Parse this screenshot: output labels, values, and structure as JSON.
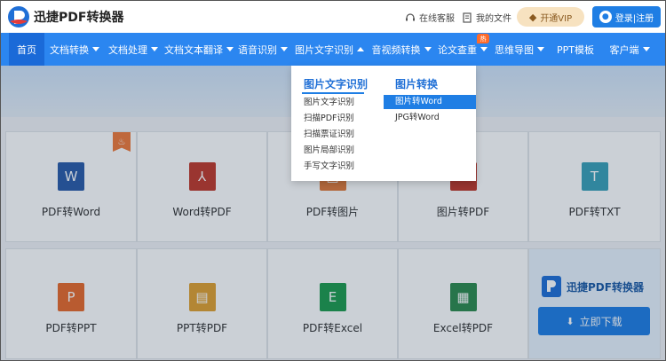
{
  "header": {
    "brand": "迅捷PDF转换器",
    "links": [
      {
        "label": "在线客服",
        "icon": "headset-icon"
      },
      {
        "label": "我的文件",
        "icon": "file-icon"
      }
    ],
    "vip_label": "开通VIP",
    "login_label": "登录|注册"
  },
  "nav": {
    "items": [
      {
        "label": "首页",
        "active": true,
        "caret": false
      },
      {
        "label": "文档转换",
        "caret": true
      },
      {
        "label": "文档处理",
        "caret": true
      },
      {
        "label": "文档文本翻译",
        "caret": true
      },
      {
        "label": "语音识别",
        "caret": true
      },
      {
        "label": "图片文字识别",
        "caret": true,
        "open": true
      },
      {
        "label": "音视频转换",
        "caret": true
      },
      {
        "label": "论文查重",
        "caret": true
      },
      {
        "label": "思维导图",
        "caret": true
      },
      {
        "label": "PPT模板",
        "caret": false
      },
      {
        "label": "客户端",
        "caret": true
      }
    ],
    "hot_badge": "热"
  },
  "dropdown": {
    "col1": {
      "title": "图片文字识别",
      "items": [
        "图片文字识别",
        "扫描PDF识别",
        "扫描票证识别",
        "图片局部识别",
        "手写文字识别"
      ]
    },
    "col2": {
      "title": "图片转换",
      "items": [
        "图片转Word",
        "JPG转Word"
      ],
      "selected": 0
    }
  },
  "cards_row1": [
    {
      "label": "PDF转Word",
      "icon": "word-file-icon",
      "glyph": "W",
      "color": "#2b5ca8"
    },
    {
      "label": "Word转PDF",
      "icon": "pdf-file-icon",
      "glyph": "⅄",
      "color": "#c0392b"
    },
    {
      "label": "PDF转图片",
      "icon": "image-file-icon",
      "glyph": "▣",
      "color": "#e07a3a"
    },
    {
      "label": "图片转PDF",
      "icon": "pdf-file-icon",
      "glyph": "⅄",
      "color": "#c0392b"
    },
    {
      "label": "PDF转TXT",
      "icon": "txt-file-icon",
      "glyph": "T",
      "color": "#3aa0b8"
    }
  ],
  "cards_row2": [
    {
      "label": "PDF转PPT",
      "icon": "ppt-file-icon",
      "glyph": "P",
      "color": "#e86a2b"
    },
    {
      "label": "PPT转PDF",
      "icon": "ppt-pdf-file-icon",
      "glyph": "▤",
      "color": "#e0a030"
    },
    {
      "label": "PDF转Excel",
      "icon": "excel-file-icon",
      "glyph": "E",
      "color": "#1e9b4e"
    },
    {
      "label": "Excel转PDF",
      "icon": "excel-pdf-file-icon",
      "glyph": "▦",
      "color": "#2e8b4e"
    }
  ],
  "promo": {
    "brand": "迅捷PDF转换器",
    "download_label": "立即下载"
  },
  "colors": {
    "nav": "#2b86f0",
    "accent": "#1f7ee4"
  }
}
